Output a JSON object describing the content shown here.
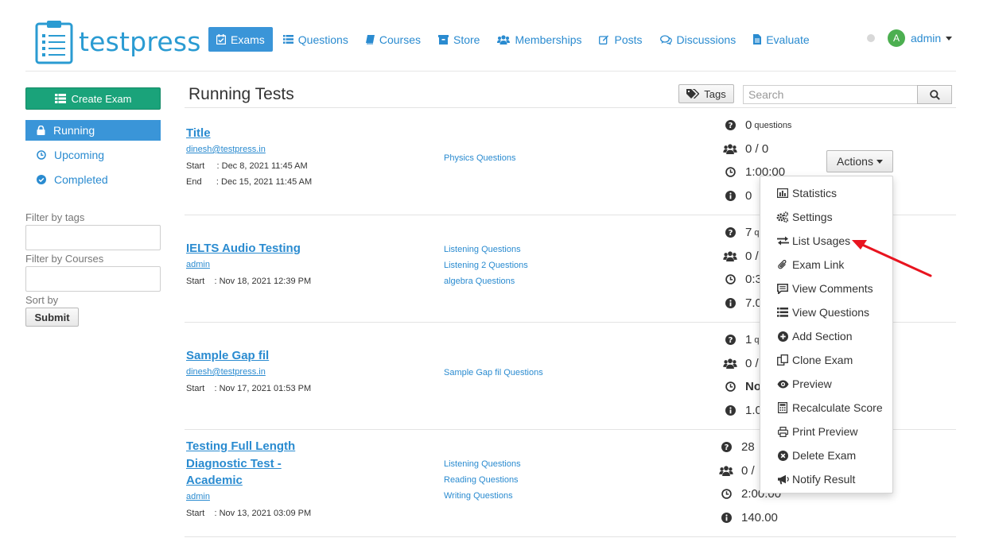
{
  "brand": {
    "name": "testpress"
  },
  "nav": {
    "items": [
      {
        "label": "Exams",
        "icon": "calendar-check-icon"
      },
      {
        "label": "Questions",
        "icon": "list-icon"
      },
      {
        "label": "Courses",
        "icon": "book-icon"
      },
      {
        "label": "Store",
        "icon": "store-icon"
      },
      {
        "label": "Memberships",
        "icon": "users-icon"
      },
      {
        "label": "Posts",
        "icon": "edit-icon"
      },
      {
        "label": "Discussions",
        "icon": "comments-icon"
      },
      {
        "label": "Evaluate",
        "icon": "file-icon"
      }
    ],
    "active_index": 0
  },
  "user": {
    "avatar_letter": "A",
    "name": "admin"
  },
  "sidebar": {
    "create_label": "Create Exam",
    "items": [
      {
        "label": "Running",
        "icon": "lock-icon"
      },
      {
        "label": "Upcoming",
        "icon": "clock-icon"
      },
      {
        "label": "Completed",
        "icon": "check-circle-icon"
      }
    ],
    "filter_tags_label": "Filter by tags",
    "filter_courses_label": "Filter by Courses",
    "sort_label": "Sort by",
    "submit_label": "Submit"
  },
  "main": {
    "title": "Running Tests",
    "tags_label": "Tags",
    "search_placeholder": "Search",
    "actions_label": "Actions"
  },
  "exams": [
    {
      "title": "Title",
      "author": "dinesh@testpress.in",
      "start": "Start     : Dec 8, 2021 11:45 AM",
      "end": "End      : Dec 15, 2021 11:45 AM",
      "question_sets": [
        "Physics Questions"
      ],
      "questions": "0",
      "questions_unit": "questions",
      "attempts": "0 / 0",
      "duration": "1:00:00",
      "marks": "0"
    },
    {
      "title": "IELTS Audio Testing",
      "author": "admin",
      "start": "Start    : Nov 18, 2021 12:39 PM",
      "question_sets": [
        "Listening Questions",
        "Listening 2 Questions",
        "algebra Questions"
      ],
      "questions": "7",
      "questions_unit": "q",
      "attempts": "0 /",
      "duration": "0:3",
      "marks": "7.0"
    },
    {
      "title": "Sample Gap fil",
      "author": "dinesh@testpress.in",
      "start": "Start    : Nov 17, 2021 01:53 PM",
      "question_sets": [
        "Sample Gap fil Questions"
      ],
      "questions": "1",
      "questions_unit": "q",
      "attempts": "0 /",
      "duration": "No",
      "marks": "1.0"
    },
    {
      "title_lines": [
        "Testing Full Length",
        "Diagnostic Test -",
        "Academic"
      ],
      "author": "admin",
      "start": "Start    : Nov 13, 2021 03:09 PM",
      "question_sets": [
        "Listening Questions",
        "Reading Questions",
        "Writing Questions"
      ],
      "questions": "28",
      "attempts": "0 /",
      "duration": "2:00:00",
      "marks": "140.00"
    }
  ],
  "actions_menu": [
    {
      "label": "Statistics",
      "icon": "bar-chart-icon"
    },
    {
      "label": "Settings",
      "icon": "cogs-icon"
    },
    {
      "label": "List Usages",
      "icon": "exchange-icon"
    },
    {
      "label": "Exam Link",
      "icon": "paperclip-icon"
    },
    {
      "label": "View Comments",
      "icon": "comment-icon"
    },
    {
      "label": "View Questions",
      "icon": "list-icon"
    },
    {
      "label": "Add Section",
      "icon": "plus-circle-icon"
    },
    {
      "label": "Clone Exam",
      "icon": "clone-icon"
    },
    {
      "label": "Preview",
      "icon": "eye-icon"
    },
    {
      "label": "Recalculate Score",
      "icon": "calculator-icon"
    },
    {
      "label": "Print Preview",
      "icon": "print-icon"
    },
    {
      "label": "Delete Exam",
      "icon": "times-circle-icon"
    },
    {
      "label": "Notify Result",
      "icon": "bullhorn-icon"
    }
  ],
  "colors": {
    "primary": "#3a95d8",
    "link": "#2a8bd0",
    "create_button": "#1aa37a",
    "annotation_arrow": "#e8141f"
  }
}
